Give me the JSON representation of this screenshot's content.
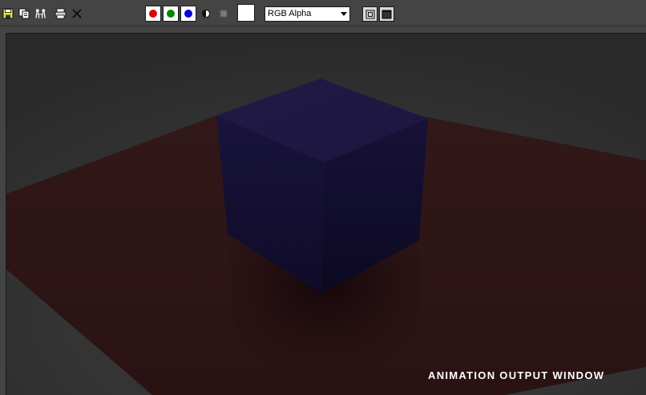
{
  "toolbar": {
    "icons": [
      {
        "name": "save-icon"
      },
      {
        "name": "clone-window-icon"
      },
      {
        "name": "compare-images-icon"
      },
      {
        "name": "print-icon"
      },
      {
        "name": "clear-icon"
      }
    ],
    "channels": [
      {
        "name": "red-channel",
        "color": "#e00000"
      },
      {
        "name": "green-channel",
        "color": "#008a00"
      },
      {
        "name": "blue-channel",
        "color": "#0000e0"
      }
    ],
    "channel_select": {
      "value": "RGB Alpha"
    }
  },
  "scene": {
    "colors": {
      "background": "#333333",
      "plane": "#2a1314",
      "cube_top": "#1e1840",
      "cube_left": "#17133a",
      "cube_right": "#151034"
    }
  },
  "caption": "ANIMATION OUTPUT WINDOW"
}
